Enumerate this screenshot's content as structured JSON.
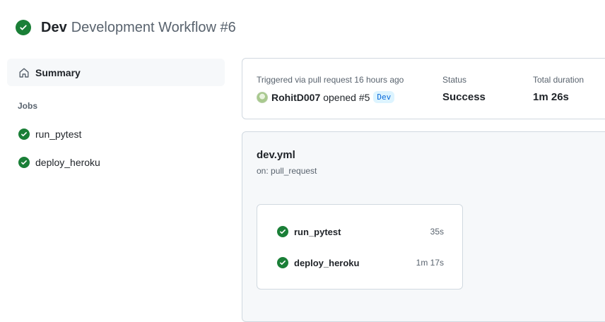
{
  "header": {
    "branch_name": "Dev",
    "workflow_title": "Development Workflow #6",
    "status_icon": "check-circle-fill-icon"
  },
  "sidebar": {
    "summary_label": "Summary",
    "summary_icon": "home-icon",
    "jobs_heading": "Jobs",
    "jobs": [
      {
        "label": "run_pytest",
        "icon": "check-circle-fill-icon"
      },
      {
        "label": "deploy_heroku",
        "icon": "check-circle-fill-icon"
      }
    ]
  },
  "summary_card": {
    "trigger_caption": "Triggered via pull request 16 hours ago",
    "user": "RohitD007",
    "action": "opened #5",
    "branch_label": "Dev",
    "status_caption": "Status",
    "status_value": "Success",
    "duration_caption": "Total duration",
    "duration_value": "1m 26s"
  },
  "workflow_graph": {
    "file_name": "dev.yml",
    "trigger": "on: pull_request",
    "jobs": [
      {
        "label": "run_pytest",
        "duration": "35s",
        "icon": "check-circle-fill-icon"
      },
      {
        "label": "deploy_heroku",
        "duration": "1m 17s",
        "icon": "check-circle-fill-icon"
      }
    ]
  },
  "colors": {
    "success": "#1a7f37",
    "muted_text": "#59636e",
    "branch_badge_bg": "#ddf4ff",
    "branch_badge_text": "#0969da"
  }
}
